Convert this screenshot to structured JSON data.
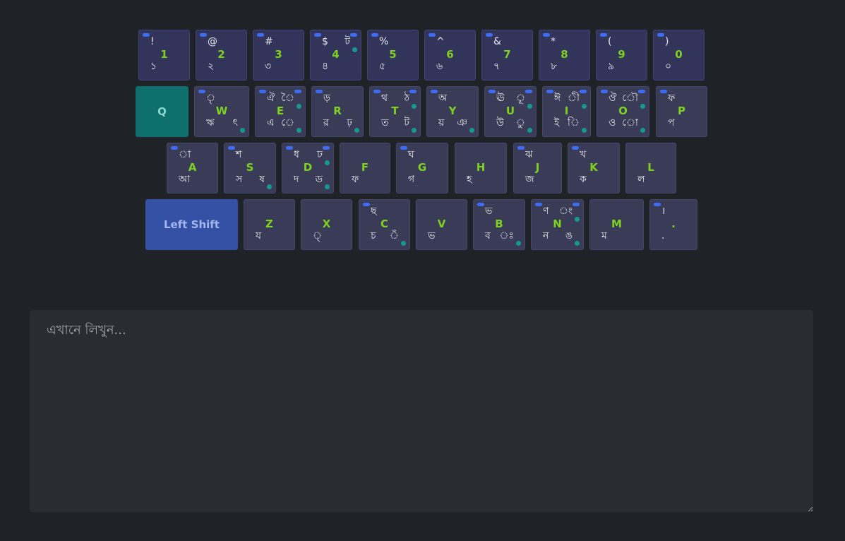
{
  "keyboard": {
    "rows": [
      [
        {
          "name": "key-1",
          "tl": "!",
          "lat": "1",
          "bl": "১",
          "dots": [
            "tl"
          ]
        },
        {
          "name": "key-2",
          "tl": "@",
          "lat": "2",
          "bl": "২",
          "dots": [
            "tl"
          ]
        },
        {
          "name": "key-3",
          "tl": "#",
          "lat": "3",
          "bl": "৩",
          "dots": [
            "tl"
          ]
        },
        {
          "name": "key-4",
          "tl": "$",
          "tr": "ট",
          "lat": "4",
          "bl": "৪",
          "dots": [
            "tl",
            "tr",
            "tru"
          ]
        },
        {
          "name": "key-5",
          "tl": "%",
          "lat": "5",
          "bl": "৫",
          "dots": [
            "tl"
          ]
        },
        {
          "name": "key-6",
          "tl": "^",
          "lat": "6",
          "bl": "৬",
          "dots": [
            "tl"
          ]
        },
        {
          "name": "key-7",
          "tl": "&",
          "lat": "7",
          "bl": "৭",
          "dots": [
            "tl"
          ]
        },
        {
          "name": "key-8",
          "tl": "*",
          "lat": "8",
          "bl": "৮",
          "dots": [
            "tl"
          ]
        },
        {
          "name": "key-9",
          "tl": "(",
          "lat": "9",
          "bl": "৯",
          "dots": [
            "tl"
          ]
        },
        {
          "name": "key-0",
          "tl": ")",
          "lat": "0",
          "bl": "০",
          "dots": [
            "tl"
          ]
        }
      ],
      [
        {
          "name": "key-q",
          "lat": "Q",
          "special": "q"
        },
        {
          "name": "key-w",
          "tl": "ৃ",
          "lat": "W",
          "bl": "ঋ",
          "br": "ৎ",
          "dots": [
            "tl",
            "brd"
          ]
        },
        {
          "name": "key-e",
          "tl": "ঐ",
          "tr": "ৈ",
          "lat": "E",
          "bl": "এ",
          "br": "ে",
          "dots": [
            "tl",
            "tr",
            "tru",
            "brd"
          ]
        },
        {
          "name": "key-r",
          "tl": "ড়",
          "lat": "R",
          "bl": "র",
          "br": "ঢ়",
          "dots": [
            "tl",
            "brd"
          ]
        },
        {
          "name": "key-t",
          "tl": "থ",
          "tr": "ঠ",
          "lat": "T",
          "bl": "ত",
          "br": "ট",
          "dots": [
            "tl",
            "tr",
            "tru",
            "brd"
          ]
        },
        {
          "name": "key-y",
          "tl": "অ",
          "lat": "Y",
          "bl": "য়",
          "br": "ঞ",
          "dots": [
            "tl",
            "brd"
          ]
        },
        {
          "name": "key-u",
          "tl": "ঊ",
          "tr": "ূ",
          "lat": "U",
          "bl": "উ",
          "br": "ু",
          "dots": [
            "tl",
            "tr",
            "tru",
            "brd"
          ]
        },
        {
          "name": "key-i",
          "tl": "ঈ",
          "tr": "ী",
          "lat": "I",
          "bl": "ই",
          "br": "ি",
          "dots": [
            "tl",
            "tr",
            "tru",
            "brd"
          ]
        },
        {
          "name": "key-o",
          "tl": "ঔ",
          "tr": "ৌ",
          "lat": "O",
          "bl": "ও",
          "br": "ো",
          "dots": [
            "tl",
            "tr",
            "tru",
            "brd"
          ]
        },
        {
          "name": "key-p",
          "tl": "ফ",
          "lat": "P",
          "bl": "প",
          "dots": [
            "tl"
          ]
        }
      ],
      [
        {
          "name": "key-a",
          "tl": "া",
          "lat": "A",
          "bl": "আ",
          "dots": [
            "tl"
          ]
        },
        {
          "name": "key-s",
          "tl": "শ",
          "lat": "S",
          "bl": "স",
          "br": "ষ",
          "dots": [
            "tl",
            "brd"
          ]
        },
        {
          "name": "key-d",
          "tl": "ধ",
          "tr": "ঢ",
          "lat": "D",
          "bl": "দ",
          "br": "ড",
          "dots": [
            "tl",
            "tr",
            "tru",
            "brd"
          ]
        },
        {
          "name": "key-f",
          "lat": "F",
          "bl": "ফ",
          "dots": []
        },
        {
          "name": "key-g",
          "tl": "ঘ",
          "lat": "G",
          "bl": "গ",
          "dots": [
            "tl"
          ]
        },
        {
          "name": "key-h",
          "lat": "H",
          "bl": "হ",
          "dots": []
        },
        {
          "name": "key-j",
          "tl": "ঝ",
          "lat": "J",
          "bl": "জ",
          "dots": [
            "tl"
          ]
        },
        {
          "name": "key-k",
          "tl": "খ",
          "lat": "K",
          "bl": "ক",
          "dots": [
            "tl"
          ]
        },
        {
          "name": "key-l",
          "lat": "L",
          "bl": "ল",
          "dots": []
        }
      ],
      [
        {
          "name": "key-left-shift",
          "lat": "Left Shift",
          "special": "shift"
        },
        {
          "name": "key-z",
          "lat": "Z",
          "bl": "য",
          "dots": []
        },
        {
          "name": "key-x",
          "lat": "X",
          "bl": "্",
          "dots": []
        },
        {
          "name": "key-c",
          "tl": "ছ",
          "lat": "C",
          "bl": "চ",
          "br": "ঁ",
          "dots": [
            "tl",
            "brd"
          ]
        },
        {
          "name": "key-v",
          "lat": "V",
          "bl": "ভ",
          "dots": []
        },
        {
          "name": "key-b",
          "tl": "ভ",
          "lat": "B",
          "bl": "ব",
          "br": "ঃ",
          "dots": [
            "tl",
            "brd"
          ]
        },
        {
          "name": "key-n",
          "tl": "ণ",
          "tr": "ং",
          "lat": "N",
          "bl": "ন",
          "br": "ঙ",
          "dots": [
            "tl",
            "tr",
            "tru",
            "brd"
          ]
        },
        {
          "name": "key-m",
          "lat": "M",
          "bl": "ম",
          "dots": []
        },
        {
          "name": "key-period",
          "tl": "।",
          "lat": ".",
          "bl": ".",
          "dots": [
            "tl"
          ]
        }
      ]
    ]
  },
  "editor": {
    "placeholder": "এখানে লিখুন..."
  },
  "colors": {
    "latin": "#7ed321",
    "dot_blue": "#3b6ef5",
    "dot_teal": "#16998c",
    "q_key": "#0f6f6d",
    "shift_key": "#3451a6"
  }
}
